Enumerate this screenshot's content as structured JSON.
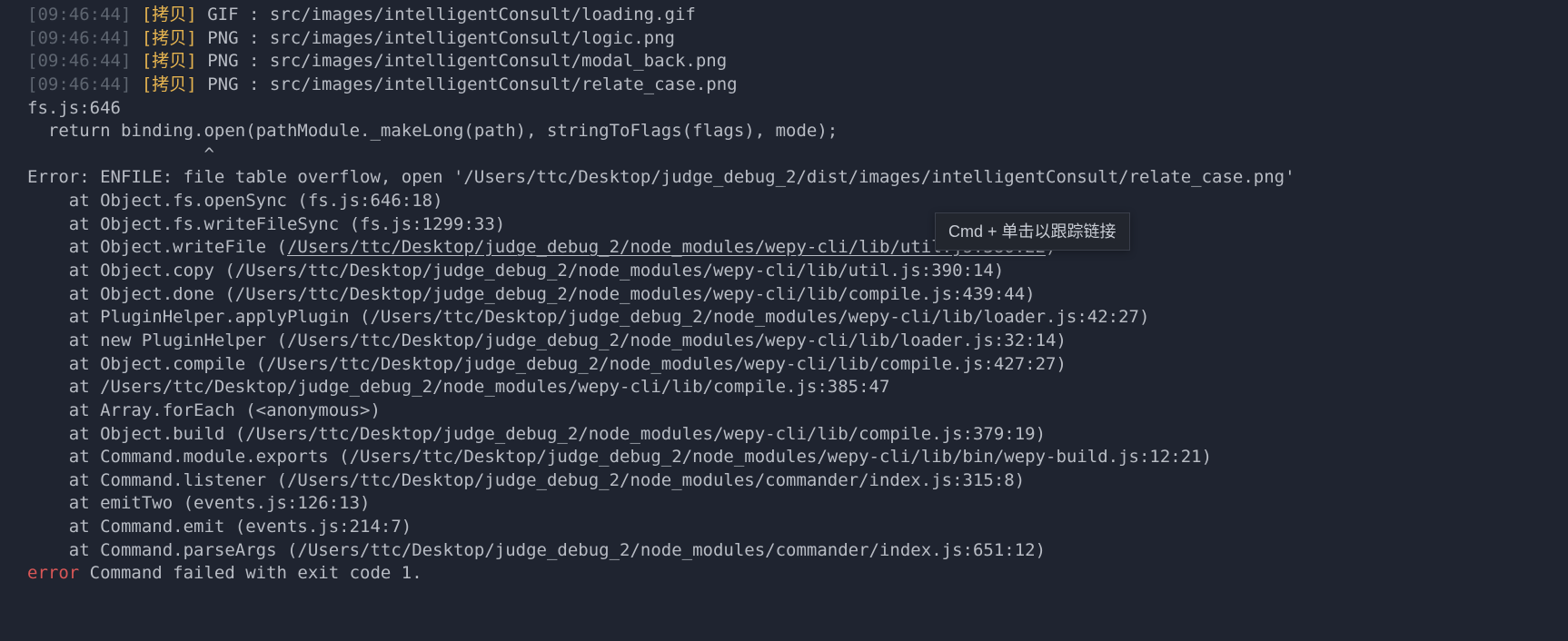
{
  "colors": {
    "background": "#1f2430",
    "text": "#b8bcc4",
    "timestamp": "#5e6570",
    "tag": "#e6b450",
    "error": "#d95757"
  },
  "timestamp": "[09:46:44]",
  "copy_label": "[拷贝]",
  "build_lines": [
    {
      "type": "GIF",
      "path": "src/images/intelligentConsult/loading.gif"
    },
    {
      "type": "PNG",
      "path": "src/images/intelligentConsult/logic.png"
    },
    {
      "type": "PNG",
      "path": "src/images/intelligentConsult/modal_back.png"
    },
    {
      "type": "PNG",
      "path": "src/images/intelligentConsult/relate_case.png"
    }
  ],
  "fs_header": "fs.js:646",
  "fs_code": "  return binding.open(pathModule._makeLong(path), stringToFlags(flags), mode);",
  "fs_caret": "                 ^",
  "blank": "",
  "error_line": "Error: ENFILE: file table overflow, open '/Users/ttc/Desktop/judge_debug_2/dist/images/intelligentConsult/relate_case.png'",
  "stack_prefix_writeFile": "    at Object.writeFile (",
  "stack_link_writeFile": "/Users/ttc/Desktop/judge_debug_2/node_modules/wepy-cli/lib/util.js:386:22",
  "stack_suffix_writeFile": ")",
  "stack": [
    "    at Object.fs.openSync (fs.js:646:18)",
    "    at Object.fs.writeFileSync (fs.js:1299:33)",
    null,
    "    at Object.copy (/Users/ttc/Desktop/judge_debug_2/node_modules/wepy-cli/lib/util.js:390:14)",
    "    at Object.done (/Users/ttc/Desktop/judge_debug_2/node_modules/wepy-cli/lib/compile.js:439:44)",
    "    at PluginHelper.applyPlugin (/Users/ttc/Desktop/judge_debug_2/node_modules/wepy-cli/lib/loader.js:42:27)",
    "    at new PluginHelper (/Users/ttc/Desktop/judge_debug_2/node_modules/wepy-cli/lib/loader.js:32:14)",
    "    at Object.compile (/Users/ttc/Desktop/judge_debug_2/node_modules/wepy-cli/lib/compile.js:427:27)",
    "    at /Users/ttc/Desktop/judge_debug_2/node_modules/wepy-cli/lib/compile.js:385:47",
    "    at Array.forEach (<anonymous>)",
    "    at Object.build (/Users/ttc/Desktop/judge_debug_2/node_modules/wepy-cli/lib/compile.js:379:19)",
    "    at Command.module.exports (/Users/ttc/Desktop/judge_debug_2/node_modules/wepy-cli/lib/bin/wepy-build.js:12:21)",
    "    at Command.listener (/Users/ttc/Desktop/judge_debug_2/node_modules/commander/index.js:315:8)",
    "    at emitTwo (events.js:126:13)",
    "    at Command.emit (events.js:214:7)",
    "    at Command.parseArgs (/Users/ttc/Desktop/judge_debug_2/node_modules/commander/index.js:651:12)"
  ],
  "final_error_keyword": "error",
  "final_error_rest": " Command failed with exit code 1.",
  "tooltip": "Cmd + 单击以跟踪链接"
}
